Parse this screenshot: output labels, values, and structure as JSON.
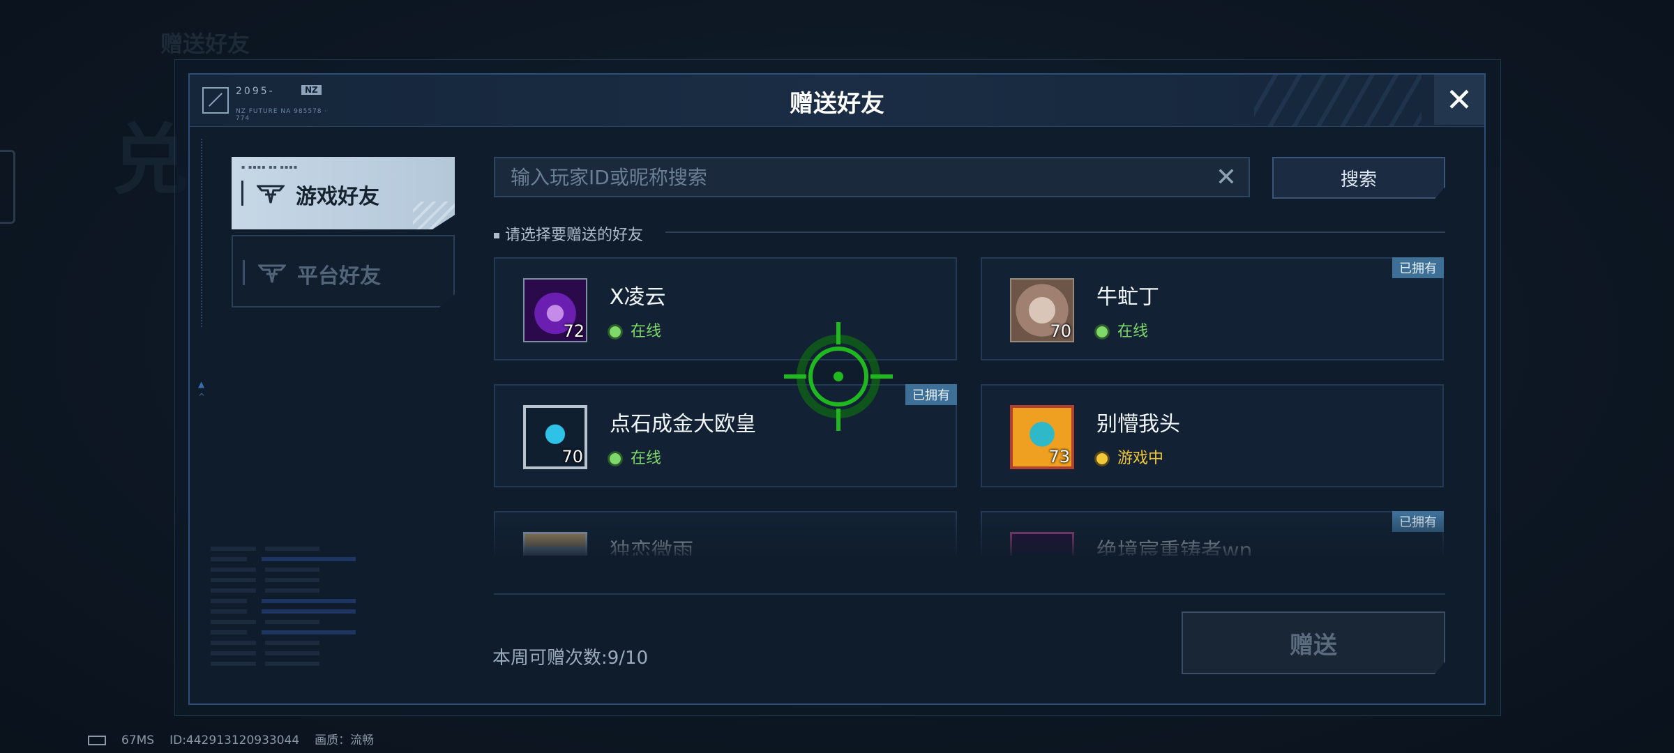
{
  "background": {
    "ghost_title": "赠送好友",
    "ghost_big": "兑"
  },
  "header": {
    "logo_code": "2095-",
    "logo_badge": "NZ",
    "logo_sub": "NZ FUTURE NA 985578 · 774",
    "title": "赠送好友",
    "close_label": "✕"
  },
  "tabs": [
    {
      "label": "游戏好友",
      "active": true,
      "icon": "game-emblem-icon"
    },
    {
      "label": "平台好友",
      "active": false,
      "icon": "game-emblem-icon"
    }
  ],
  "search": {
    "placeholder": "输入玩家ID或昵称搜索",
    "value": "",
    "clear_label": "✕",
    "button_label": "搜索"
  },
  "section": {
    "label": "请选择要赠送的好友"
  },
  "friends": [
    {
      "name": "X凌云",
      "level": "72",
      "status": "在线",
      "status_type": "online",
      "owned": ""
    },
    {
      "name": "牛虻丁",
      "level": "70",
      "status": "在线",
      "status_type": "online",
      "owned": "已拥有"
    },
    {
      "name": "点石成金大欧皇",
      "level": "70",
      "status": "在线",
      "status_type": "online",
      "owned": "已拥有"
    },
    {
      "name": "别懵我头",
      "level": "73",
      "status": "游戏中",
      "status_type": "ingame",
      "owned": ""
    },
    {
      "name": "独恋微雨",
      "level": "",
      "status": "",
      "status_type": "",
      "owned": ""
    },
    {
      "name": "绝境宸重铸者wn",
      "level": "",
      "status": "",
      "status_type": "",
      "owned": "已拥有"
    }
  ],
  "footer": {
    "weekly_label": "本周可赠次数:9/10",
    "gift_button": "赠送"
  },
  "status_bar": {
    "ping": "67MS",
    "player_id": "ID:442913120933044",
    "quality": "画质：流畅"
  },
  "colors": {
    "online": "#7fd86a",
    "ingame": "#f2c83a",
    "owned_badge": "#3d6f97",
    "crosshair": "#1fb81f"
  }
}
